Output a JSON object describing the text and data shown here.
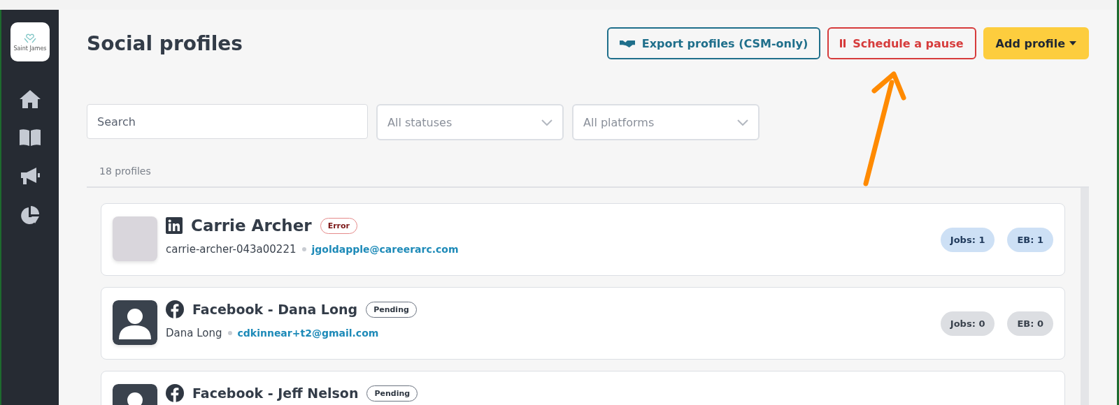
{
  "sidebar": {
    "logo_text": "Saint James",
    "items": [
      {
        "kind": "home"
      },
      {
        "kind": "book"
      },
      {
        "kind": "megaphone"
      },
      {
        "kind": "chart"
      }
    ]
  },
  "header": {
    "title": "Social profiles",
    "buttons": [
      {
        "kind": "export",
        "label": "Export profiles (CSM-only)"
      },
      {
        "kind": "pause",
        "label": "Schedule a pause"
      },
      {
        "kind": "add",
        "label": "Add profile"
      }
    ]
  },
  "filters": {
    "search": {
      "placeholder": "Search"
    },
    "dropdowns": [
      {
        "value": "All statuses"
      },
      {
        "value": "All platforms"
      }
    ]
  },
  "count": "18 profiles",
  "profiles": [
    {
      "avatar": {
        "kind": "photo"
      },
      "platform": {
        "kind": "linkedin"
      },
      "name": "Carrie Archer",
      "status": {
        "kind": "error",
        "label": "Error"
      },
      "handle": "carrie-archer-043a00221",
      "email": "jgoldapple@careerarc.com",
      "badges": [
        {
          "label": "Jobs: 1",
          "highlighted": true
        },
        {
          "label": "EB: 1",
          "highlighted": true
        }
      ]
    },
    {
      "avatar": {
        "kind": "default"
      },
      "platform": {
        "kind": "facebook"
      },
      "name": "Facebook - Dana Long",
      "status": {
        "kind": "pending",
        "label": "Pending"
      },
      "handle": "Dana Long",
      "email": "cdkinnear+t2@gmail.com",
      "badges": [
        {
          "label": "Jobs: 0",
          "highlighted": false
        },
        {
          "label": "EB: 0",
          "highlighted": false
        }
      ]
    },
    {
      "avatar": {
        "kind": "default"
      },
      "platform": {
        "kind": "facebook"
      },
      "name": "Facebook - Jeff Nelson",
      "status": {
        "kind": "pending",
        "label": "Pending"
      }
    }
  ]
}
